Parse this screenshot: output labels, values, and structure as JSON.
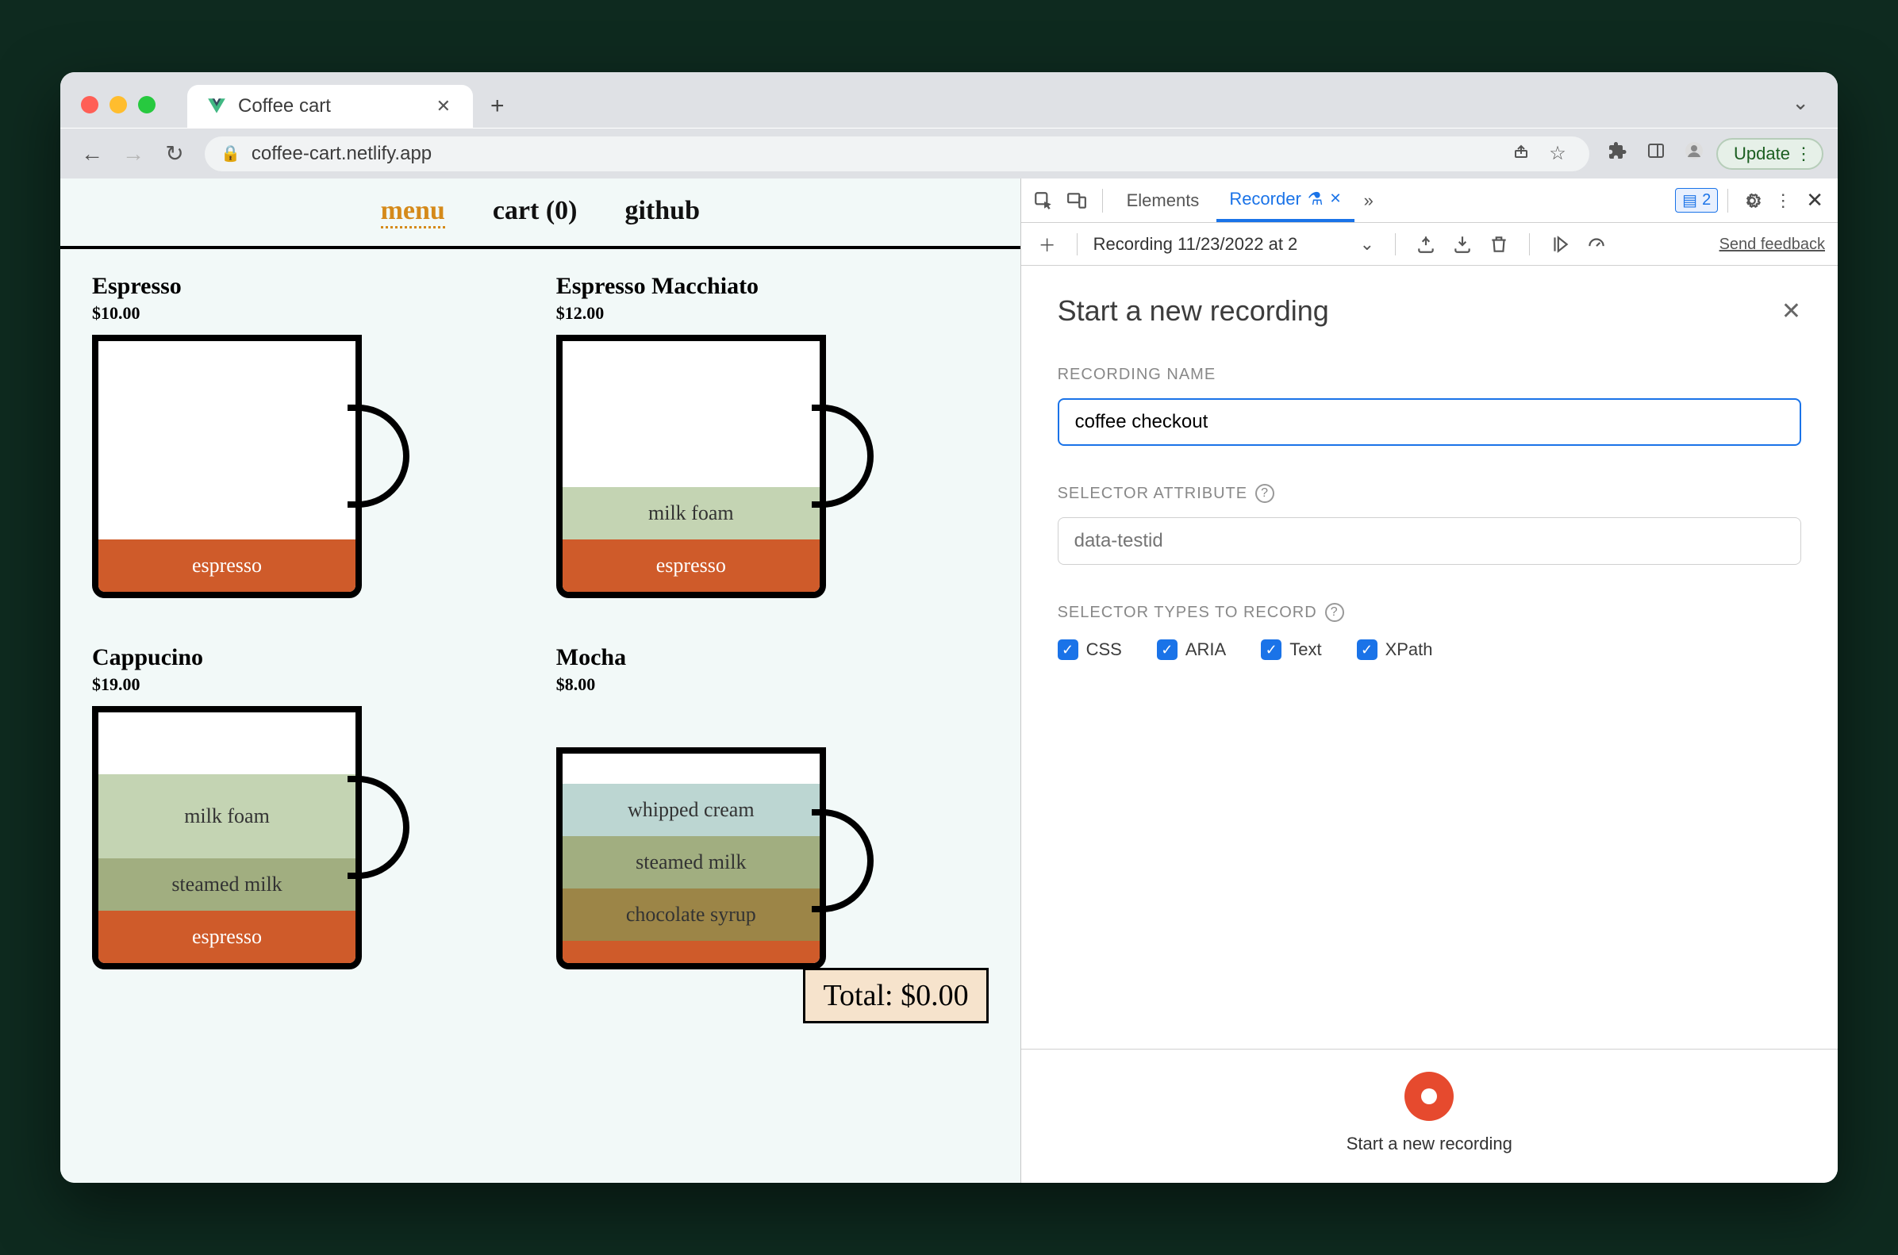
{
  "browser": {
    "tab_title": "Coffee cart",
    "url": "coffee-cart.netlify.app",
    "update_label": "Update"
  },
  "app": {
    "nav": {
      "menu": "menu",
      "cart": "cart (0)",
      "github": "github"
    },
    "products": [
      {
        "name": "Espresso",
        "price": "$10.00",
        "layers": [
          {
            "cls": "l-esp",
            "label": "espresso"
          }
        ]
      },
      {
        "name": "Espresso Macchiato",
        "price": "$12.00",
        "layers": [
          {
            "cls": "l-foam",
            "label": "milk foam"
          },
          {
            "cls": "l-esp",
            "label": "espresso"
          }
        ]
      },
      {
        "name": "Cappucino",
        "price": "$19.00",
        "layers": [
          {
            "cls": "l-foam",
            "label": "milk foam"
          },
          {
            "cls": "l-steam",
            "label": "steamed milk"
          },
          {
            "cls": "l-esp",
            "label": "espresso"
          }
        ]
      },
      {
        "name": "Mocha",
        "price": "$8.00",
        "layers": [
          {
            "cls": "l-whip",
            "label": "whipped cream"
          },
          {
            "cls": "l-steam",
            "label": "steamed milk"
          },
          {
            "cls": "l-choc",
            "label": "chocolate syrup"
          },
          {
            "cls": "l-esp",
            "label": ""
          }
        ]
      }
    ],
    "total_label": "Total: $0.00"
  },
  "devtools": {
    "tabs": {
      "elements": "Elements",
      "recorder": "Recorder"
    },
    "issues_count": "2",
    "toolbar": {
      "recording_dropdown": "Recording 11/23/2022 at 2",
      "feedback": "Send feedback"
    },
    "panel": {
      "title": "Start a new recording",
      "recording_name_label": "RECORDING NAME",
      "recording_name_value": "coffee checkout",
      "selector_attr_label": "SELECTOR ATTRIBUTE",
      "selector_attr_placeholder": "data-testid",
      "selector_types_label": "SELECTOR TYPES TO RECORD",
      "types": {
        "css": "CSS",
        "aria": "ARIA",
        "text": "Text",
        "xpath": "XPath"
      }
    },
    "footer_label": "Start a new recording"
  }
}
